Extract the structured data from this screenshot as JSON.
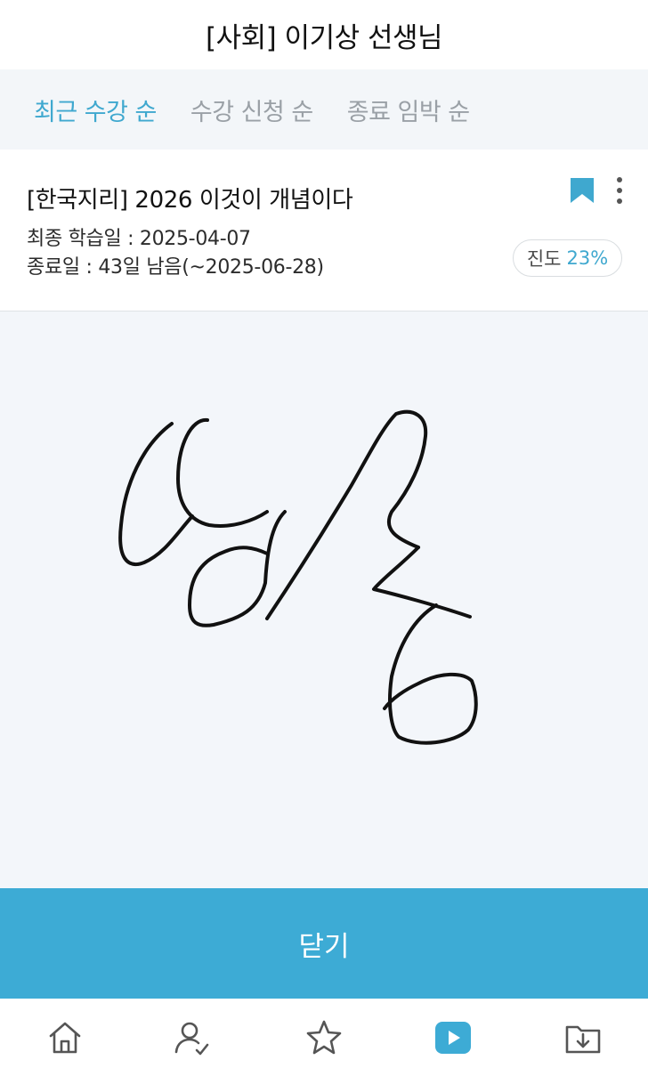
{
  "header": {
    "title": "[사회] 이기상 선생님"
  },
  "tabs": [
    {
      "label": "최근 수강 순",
      "active": true
    },
    {
      "label": "수강 신청 순",
      "active": false
    },
    {
      "label": "종료 임박 순",
      "active": false
    }
  ],
  "course": {
    "title": "[한국지리] 2026 이것이 개념이다",
    "last_study": "최종 학습일 : 2025-04-07",
    "end_date": "종료일 : 43일 남음(~2025-06-28)",
    "progress_label": "진도",
    "progress_value": "23%"
  },
  "close_button": {
    "label": "닫기"
  },
  "colors": {
    "accent": "#3dabd5",
    "tab_active": "#3fa8cf",
    "canvas_bg": "#f3f6fa"
  },
  "bottom_nav": [
    "home-icon",
    "person-icon",
    "star-icon",
    "play-icon",
    "download-folder-icon"
  ]
}
